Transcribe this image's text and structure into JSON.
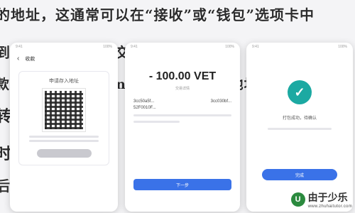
{
  "background_lines": [
    "的地址，这通常可以在“接收”或“钱包”选项卡中",
    "到你其他的钱包或交易所。",
    "款，来                  制的 TokenTokenim 钱包地址",
    "转           误，",
    "时间，以便区块",
    "后你安排自己的"
  ],
  "left_card": {
    "status_left": "9:41",
    "status_right": "100%",
    "header_title": "收款",
    "request_title": "申请存入地址"
  },
  "center_card": {
    "status_left": "9:41",
    "status_right": "100%",
    "amount": "- 100.00 VET",
    "sub_text": "交易详情",
    "from_address": "3cc50a5f...",
    "to_address": "3cc030bf...",
    "from_label": "52F0010F...",
    "confirm_label": "下一步"
  },
  "right_card": {
    "status_left": "9:41",
    "status_right": "100%",
    "success_icon": "checkmark-icon",
    "success_text": "打包成功，待确认",
    "done_label": "完成"
  },
  "watermark": {
    "text": "由于少乐",
    "url": "www.zhuhaitutor.com"
  },
  "colors": {
    "accent": "#3a72e8",
    "success": "#1ca9a2",
    "background": "#f4f4f6"
  }
}
